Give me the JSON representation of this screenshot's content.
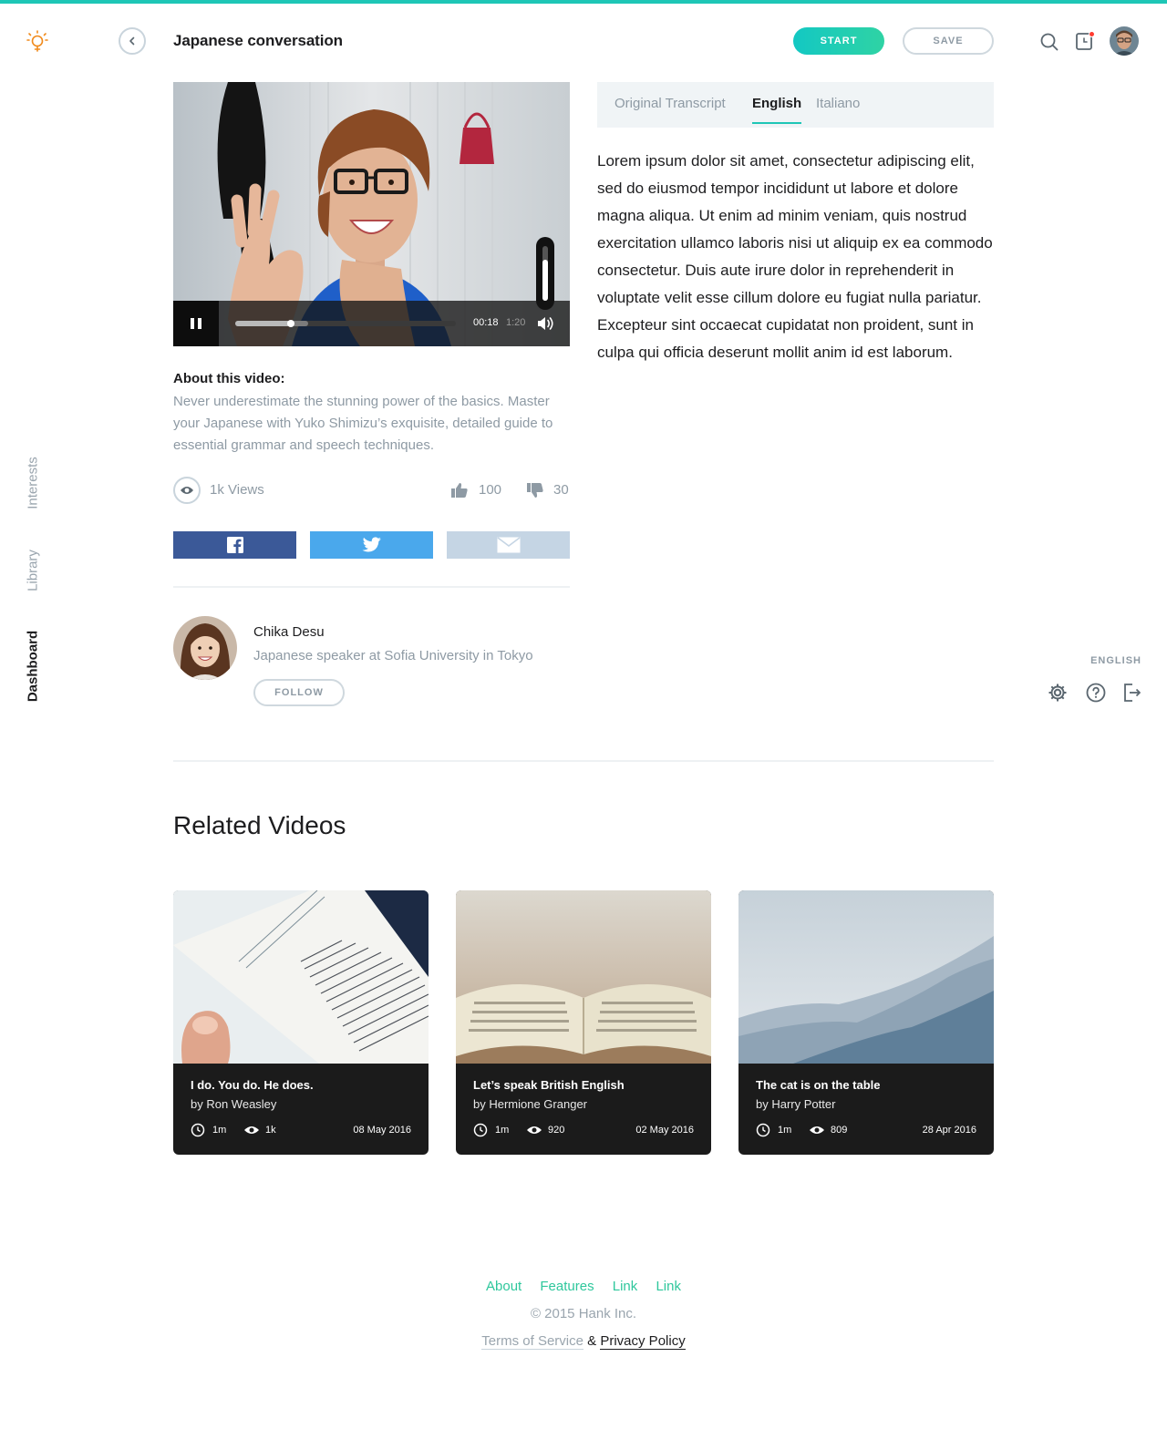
{
  "header": {
    "title": "Japanese conversation",
    "start_label": "START",
    "save_label": "SAVE"
  },
  "nav": {
    "items": [
      {
        "label": "Interests",
        "active": false
      },
      {
        "label": "Library",
        "active": false
      },
      {
        "label": "Dashboard",
        "active": true
      }
    ]
  },
  "utilities": {
    "language": "ENGLISH"
  },
  "player": {
    "current_time": "00:18",
    "duration": "1:20",
    "played_fraction": 0.25,
    "buffered_fraction": 0.33,
    "volume_fraction": 0.75
  },
  "about": {
    "heading": "About this video:",
    "description": "Never underestimate the stunning power of the basics. Master your Japanese with Yuko Shimizu’s exquisite, detailed guide to essential grammar and speech techniques."
  },
  "stats": {
    "views": "1k Views",
    "likes": "100",
    "dislikes": "30"
  },
  "speaker": {
    "name": "Chika Desu",
    "role": "Japanese speaker at Sofia University in Tokyo",
    "follow_label": "FOLLOW"
  },
  "transcript": {
    "tabs": [
      {
        "label": "Original Transcript",
        "active": false
      },
      {
        "label": "English",
        "active": true
      },
      {
        "label": "Italiano",
        "active": false
      }
    ],
    "text": "Lorem ipsum dolor sit amet, consectetur adipiscing elit, sed do eiusmod tempor incididunt ut labore et dolore magna aliqua. Ut enim ad minim veniam, quis nostrud exercitation ullamco laboris nisi ut aliquip ex ea commodo consectetur. Duis aute irure dolor in reprehenderit in voluptate velit esse cillum dolore eu fugiat nulla pariatur. Excepteur sint occaecat cupidatat non proident, sunt in culpa qui officia deserunt mollit anim id est laborum."
  },
  "related": {
    "heading": "Related Videos",
    "cards": [
      {
        "title": "I do. You do. He does.",
        "author": "by Ron Weasley",
        "duration": "1m",
        "views": "1k",
        "date": "08 May 2016"
      },
      {
        "title": "Let’s speak British English",
        "author": "by Hermione Granger",
        "duration": "1m",
        "views": "920",
        "date": "02 May 2016"
      },
      {
        "title": "The cat is on the table",
        "author": "by Harry Potter",
        "duration": "1m",
        "views": "809",
        "date": "28 Apr 2016"
      }
    ]
  },
  "footer": {
    "links": [
      "About",
      "Features",
      "Link",
      "Link"
    ],
    "copyright": "© 2015 Hank Inc.",
    "terms": "Terms of Service",
    "amp": "&",
    "privacy": "Privacy Policy"
  },
  "colors": {
    "accent": "#1ec6b6",
    "facebook": "#3b5998",
    "twitter": "#4aa8ec",
    "email": "#c5d5e4",
    "footer_link": "#2ec79c"
  }
}
